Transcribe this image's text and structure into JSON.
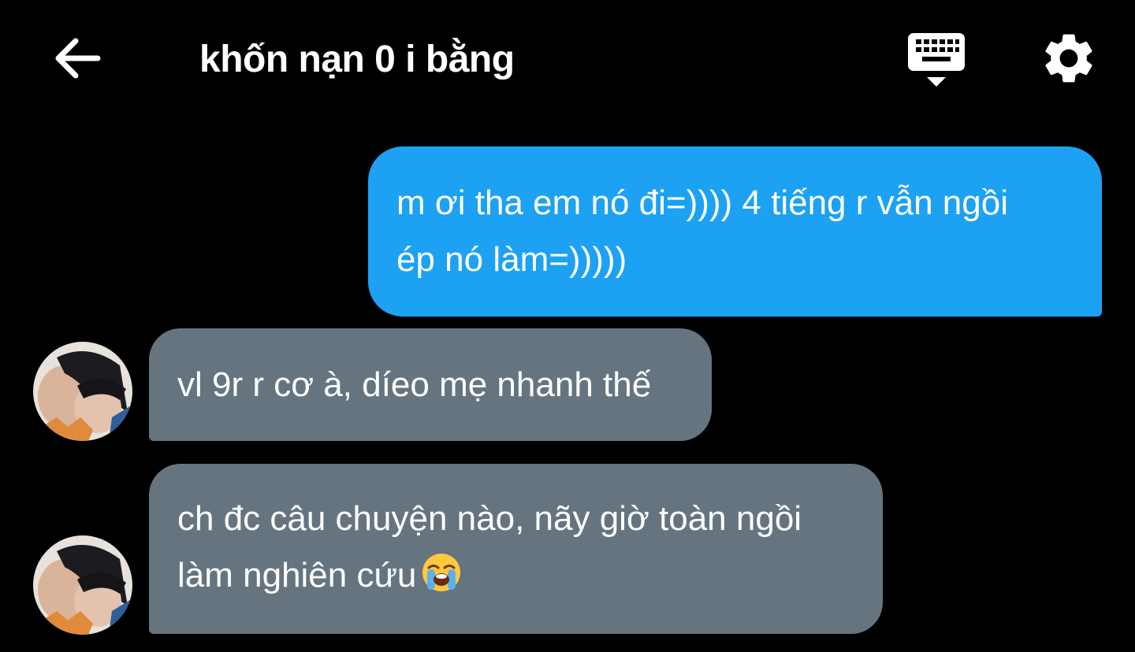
{
  "header": {
    "title": "khốn nạn 0 i bằng",
    "back_icon": "arrow-left-icon",
    "keyboard_icon": "keyboard-hide-icon",
    "settings_icon": "gear-icon"
  },
  "messages": [
    {
      "sender": "me",
      "lines": [
        "m ơi tha em nó đi=)))) 4 tiếng r vẫn ngồi",
        "ép nó làm=)))))"
      ],
      "color": "#1da1f2"
    },
    {
      "sender": "other",
      "lines": [
        "vl 9r r cơ à, díeo mẹ nhanh thế"
      ],
      "color": "#66747f"
    },
    {
      "sender": "other",
      "lines": [
        "ch đc câu chuyện nào, nãy giờ toàn ngồi",
        "làm nghiên cứu"
      ],
      "emoji": "loudly-crying-face-emoji",
      "color": "#66747f"
    }
  ],
  "colors": {
    "background": "#000000",
    "sent_bubble": "#1da1f2",
    "received_bubble": "#66747f",
    "text": "#ffffff"
  }
}
